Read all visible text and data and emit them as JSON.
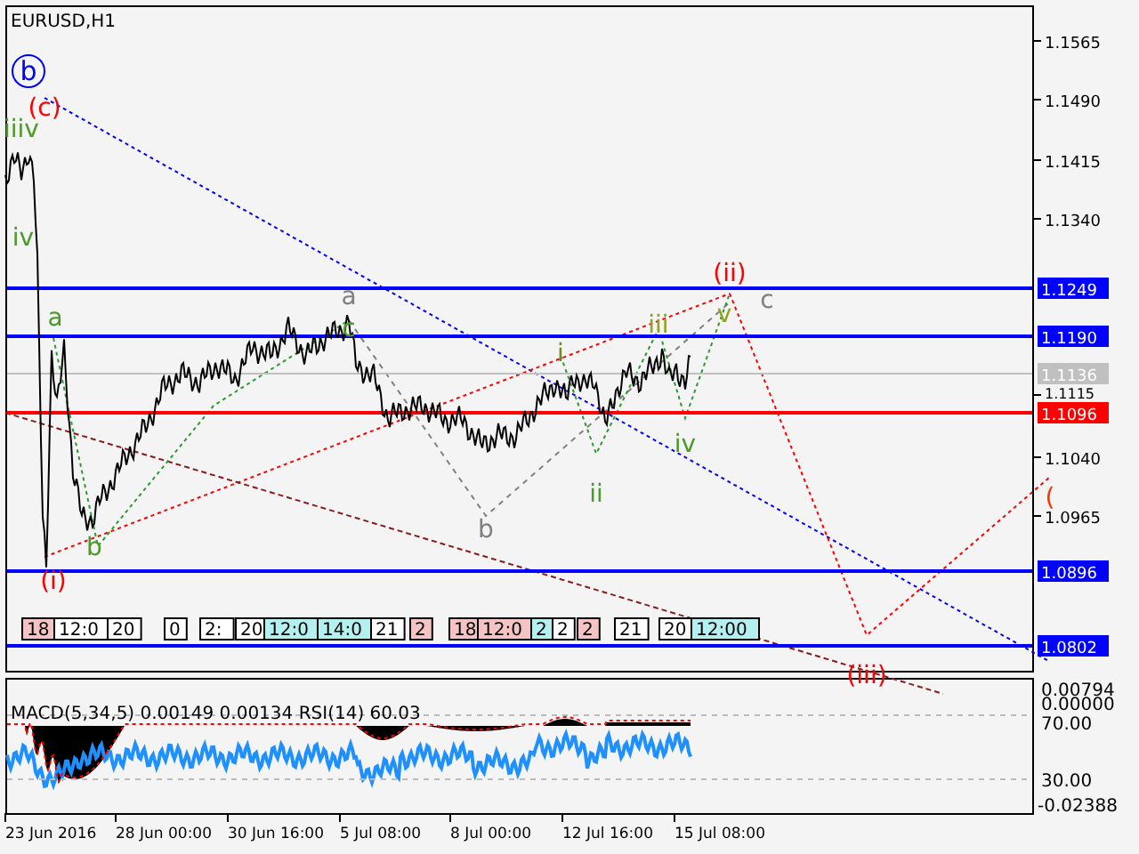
{
  "title": "EURUSD,H1",
  "price_axis": [
    "1.1565",
    "1.1490",
    "1.1415",
    "1.1340",
    "1.1115",
    "1.1040",
    "1.0965"
  ],
  "levels": [
    {
      "label": "1.1249",
      "color": "#0000ff"
    },
    {
      "label": "1.1190",
      "color": "#0000ff"
    },
    {
      "label": "1.1136",
      "color": "#c0c0c0"
    },
    {
      "label": "1.1096",
      "color": "#ff0000"
    },
    {
      "label": "1.0896",
      "color": "#0000ff"
    },
    {
      "label": "1.0802",
      "color": "#0000ff"
    }
  ],
  "wave_labels": [
    {
      "text": "b",
      "color": "#0000ff",
      "kind": "circled"
    },
    {
      "text": "(c)",
      "color": "#ff0000",
      "kind": "plain"
    },
    {
      "text": "iiiv",
      "color": "#4c9a2a",
      "kind": "plain"
    },
    {
      "text": "iv",
      "color": "#4c9a2a",
      "kind": "plain"
    },
    {
      "text": "a",
      "color": "#4c9a2a",
      "kind": "plain"
    },
    {
      "text": "(i)",
      "color": "#ff0000",
      "kind": "plain"
    },
    {
      "text": "b",
      "color": "#4c9a2a",
      "kind": "plain"
    },
    {
      "text": "a",
      "color": "#808080",
      "kind": "plain"
    },
    {
      "text": "c",
      "color": "#4c9a2a",
      "kind": "plain"
    },
    {
      "text": "b",
      "color": "#808080",
      "kind": "plain"
    },
    {
      "text": "i",
      "color": "#6b8e23",
      "kind": "plain"
    },
    {
      "text": "ii",
      "color": "#4c9a2a",
      "kind": "plain"
    },
    {
      "text": "iii",
      "color": "#8fa31f",
      "kind": "plain"
    },
    {
      "text": "iv",
      "color": "#4c9a2a",
      "kind": "plain"
    },
    {
      "text": "c",
      "color": "#808080",
      "kind": "plain"
    },
    {
      "text": "v",
      "color": "#8fa31f",
      "kind": "plain"
    },
    {
      "text": "(ii)",
      "color": "#ff0000",
      "kind": "plain"
    },
    {
      "text": "(iii)",
      "color": "#ff0000",
      "kind": "plain"
    },
    {
      "text": "(",
      "color": "#ff3300",
      "kind": "plain"
    }
  ],
  "event_tags": [
    {
      "text": "18",
      "color": "#f4c4c4"
    },
    {
      "text": "12:0",
      "color": "#ffffff"
    },
    {
      "text": "20",
      "color": "#ffffff"
    },
    {
      "text": "0",
      "color": "#ffffff"
    },
    {
      "text": "2:",
      "color": "#ffffff"
    },
    {
      "text": "20",
      "color": "#ffffff"
    },
    {
      "text": "12:0",
      "color": "#b4f0f0"
    },
    {
      "text": "14:0",
      "color": "#b4f0f0"
    },
    {
      "text": "21",
      "color": "#ffffff"
    },
    {
      "text": "2",
      "color": "#f4c4c4"
    },
    {
      "text": "18",
      "color": "#f4c4c4"
    },
    {
      "text": "12:0",
      "color": "#f4c4c4"
    },
    {
      "text": "2",
      "color": "#b4f0f0"
    },
    {
      "text": "2",
      "color": "#ffffff"
    },
    {
      "text": "2",
      "color": "#f4c4c4"
    },
    {
      "text": "21",
      "color": "#ffffff"
    },
    {
      "text": "20",
      "color": "#ffffff"
    },
    {
      "text": "12:00",
      "color": "#b4f0f0"
    }
  ],
  "indicator": {
    "label": "MACD(5,34,5) 0.00149 0.00134 RSI(14) 60.03",
    "axis": [
      "0.00794",
      "0.00000",
      "70.00",
      "30.00",
      "-0.02388"
    ]
  },
  "time_axis": [
    "23 Jun 2016",
    "28 Jun 00:00",
    "30 Jun 16:00",
    "5 Jul 08:00",
    "8 Jul 00:00",
    "12 Jul 16:00",
    "15 Jul 08:00"
  ]
}
